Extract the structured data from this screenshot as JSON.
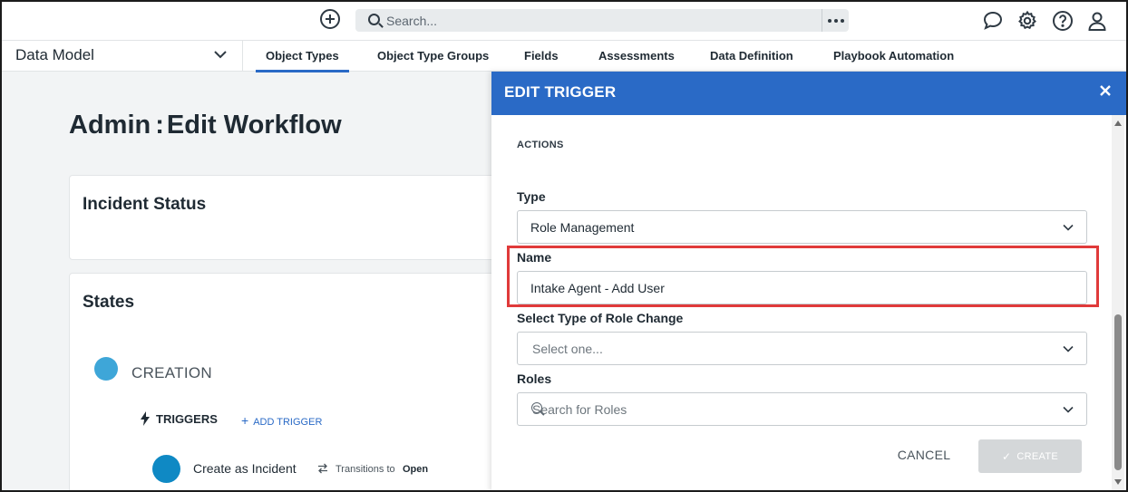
{
  "topbar": {
    "search_placeholder": "Search..."
  },
  "navbar": {
    "module": "Data Model",
    "tabs": [
      {
        "label": "Object Types",
        "active": true
      },
      {
        "label": "Object Type Groups"
      },
      {
        "label": "Fields"
      },
      {
        "label": "Assessments"
      },
      {
        "label": "Data Definition"
      },
      {
        "label": "Playbook Automation"
      }
    ]
  },
  "page": {
    "title_prefix": "Admin",
    "title_sep": ":",
    "title_main": "Edit Workflow",
    "status_card_title": "Incident Status",
    "states_card_title": "States",
    "state_name": "CREATION",
    "triggers_label": "TRIGGERS",
    "add_trigger_label": "ADD TRIGGER",
    "trigger_name": "Create as Incident",
    "transitions_to": "Transitions to",
    "transition_target": "Open"
  },
  "drawer": {
    "title": "EDIT TRIGGER",
    "section": "ACTIONS",
    "type_label": "Type",
    "type_value": "Role Management",
    "name_label": "Name",
    "name_value": "Intake Agent - Add User",
    "role_change_label": "Select Type of Role Change",
    "role_change_placeholder": "Select one...",
    "roles_label": "Roles",
    "roles_placeholder": "Search for Roles",
    "cancel_label": "CANCEL",
    "create_label": "CREATE"
  },
  "colors": {
    "accent": "#2a6ac6",
    "highlight": "#e03a3a",
    "state_dot": "#3ea6d8",
    "trigger_dot": "#0f89c4"
  }
}
